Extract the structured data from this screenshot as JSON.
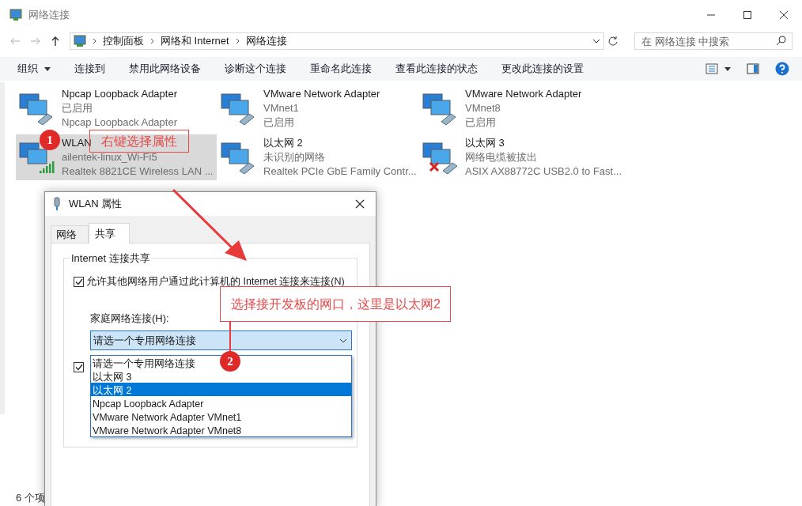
{
  "window": {
    "title": "网络连接"
  },
  "address": {
    "path": [
      "控制面板",
      "网络和 Internet",
      "网络连接"
    ],
    "search_placeholder": "在 网络连接 中搜索"
  },
  "toolbar": [
    "组织",
    "连接到",
    "禁用此网络设备",
    "诊断这个连接",
    "重命名此连接",
    "查看此连接的状态",
    "更改此连接的设置"
  ],
  "adapters": [
    {
      "name": "Npcap Loopback Adapter",
      "lines": [
        "已启用",
        "Npcap Loopback Adapter"
      ],
      "kind": "cable",
      "selected": false
    },
    {
      "name": "VMware Network Adapter",
      "lines": [
        "VMnet1",
        "已启用"
      ],
      "kind": "cable",
      "selected": false
    },
    {
      "name": "VMware Network Adapter",
      "lines": [
        "VMnet8",
        "已启用"
      ],
      "kind": "cable",
      "selected": false
    },
    {
      "name": "WLAN",
      "lines": [
        "ailentek-linux_Wi-Fi5",
        "Realtek 8821CE Wireless LAN ..."
      ],
      "kind": "wifi",
      "selected": true
    },
    {
      "name": "以太网 2",
      "lines": [
        "未识别的网络",
        "Realtek PCIe GbE Family Contr..."
      ],
      "kind": "cable",
      "selected": false
    },
    {
      "name": "以太网 3",
      "lines": [
        "网络电缆被拔出",
        "ASIX AX88772C USB2.0 to Fast..."
      ],
      "kind": "unplugged",
      "selected": false
    }
  ],
  "status_bar": "6 个项",
  "dialog": {
    "title": "WLAN 属性",
    "tabs": [
      {
        "label": "网络",
        "selected": false
      },
      {
        "label": "共享",
        "selected": true
      }
    ],
    "group_title": "Internet 连接共享",
    "allow_sharing": {
      "label": "允许其他网络用户通过此计算机的 Internet 连接来连接(N)",
      "checked": true
    },
    "home_label": "家庭网络连接(H):",
    "combo_value": "请选一个专用网络连接",
    "options": [
      {
        "label": "请选一个专用网络连接",
        "selected": false
      },
      {
        "label": "以太网 3",
        "selected": false
      },
      {
        "label": "以太网 2",
        "selected": true
      },
      {
        "label": "Npcap Loopback Adapter",
        "selected": false
      },
      {
        "label": "VMware Network Adapter VMnet1",
        "selected": false
      },
      {
        "label": "VMware Network Adapter VMnet8",
        "selected": false
      }
    ],
    "allow_control": {
      "checked": true
    }
  },
  "annotations": [
    {
      "badge": "1",
      "text": "右键选择属性"
    },
    {
      "badge": "2",
      "text": "选择接开发板的网口，这里是以太网2"
    }
  ]
}
